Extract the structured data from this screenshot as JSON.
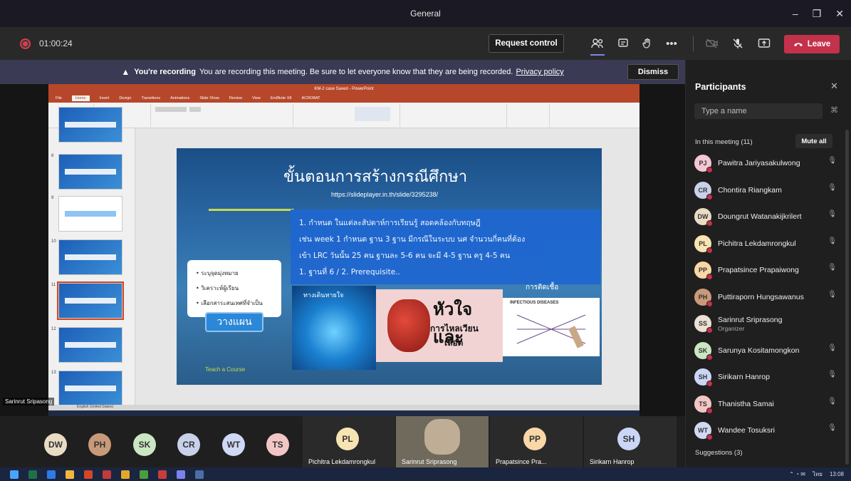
{
  "window": {
    "title": "General",
    "minimize": "–",
    "maximize": "❐",
    "close": "✕"
  },
  "toolbar": {
    "timer": "01:00:24",
    "request_control": "Request control",
    "more": "•••",
    "leave": "Leave"
  },
  "banner": {
    "bold": "You're recording",
    "message": "You are recording this meeting. Be sure to let everyone know that they are being recorded.",
    "link": "Privacy policy",
    "dismiss": "Dismiss"
  },
  "ppt": {
    "window_title": "KM-2 case Saved - PowerPoint",
    "tabs": [
      "File",
      "Home",
      "Insert",
      "Design",
      "Transitions",
      "Animations",
      "Slide Show",
      "Review",
      "View",
      "EndNote X8",
      "ACROBAT"
    ],
    "slide_numbers": [
      "8",
      "9",
      "10",
      "11",
      "12",
      "13"
    ],
    "status_text": "English (United States)",
    "presenter_label": "Sarinrut Sripasong"
  },
  "slide": {
    "title": "ขั้นตอนการสร้างกรณีศึกษา",
    "url": "https://slideplayer.in.th/slide/3295238/",
    "lines": [
      "1.   กำหนด ในแต่ละสัปดาห์การเรียนรู้ สอดคล้องกับทฤษฎี",
      "  เช่น week 1  กำหนด ฐาน 3 ฐาน มีกรณีในระบบ นศ จำนวนกี่คนที่ต้อง",
      "เข้า LRC วันนั้น 25 คน ฐานละ 5-6 คน จะมี 4-5 ฐาน ครู 4-5 คน",
      "1. ฐานที่ 6  /  2. Prerequisite.."
    ],
    "bullets": [
      "• ระบุจุดมุ่งหมาย",
      "• วิเคราะห์ผู้เรียน",
      "• เลือกสาระสนเทศที่จำเป็น"
    ],
    "plan_button": "วางแผน",
    "lungs_caption": "ทางเดินหายใจ",
    "heart_title": "หัวใจ และ",
    "heart_sub1": "การไหลเวียน",
    "heart_sub2": "เลือด",
    "infection_label": "การติดเชื้อ",
    "infection_heading": "INFECTIOUS DISEASES",
    "teach": "Teach a Course"
  },
  "panel": {
    "title": "Participants",
    "close": "✕",
    "search_placeholder": "Type a name",
    "in_meeting": "In this meeting (11)",
    "mute_all": "Mute all",
    "suggestions": "Suggestions (3)",
    "participants": [
      {
        "initials": "PJ",
        "name": "Pawitra Jariyasakulwong",
        "color": "#f4c7d3"
      },
      {
        "initials": "CR",
        "name": "Chontira Riangkam",
        "color": "#c8d1ea"
      },
      {
        "initials": "DW",
        "name": "Doungrut Watanakijkrilert",
        "color": "#e9dcc5"
      },
      {
        "initials": "PL",
        "name": "Pichitra Lekdamrongkul",
        "color": "#f6e4b2"
      },
      {
        "initials": "PP",
        "name": "Prapatsince Prapaiwong",
        "color": "#f9d7a6"
      },
      {
        "initials": "PH",
        "name": "Puttiraporn Hungsawanus",
        "color": "#c99a7a"
      },
      {
        "initials": "SS",
        "name": "Sarinrut Sriprasong",
        "sub": "Organizer",
        "color": "#ece1d4"
      },
      {
        "initials": "SK",
        "name": "Sarunya Kositamongkon",
        "color": "#c9e7c2"
      },
      {
        "initials": "SH",
        "name": "Sirikarn Hanrop",
        "color": "#cbd6f6"
      },
      {
        "initials": "TS",
        "name": "Thanistha Samai",
        "color": "#f3c6c6"
      },
      {
        "initials": "WT",
        "name": "Wandee Tosuksri",
        "color": "#cfd9f4"
      }
    ]
  },
  "strip": {
    "avatars": [
      {
        "initials": "DW",
        "color": "#e9dcc5"
      },
      {
        "initials": "PH",
        "color": "#c99a7a"
      },
      {
        "initials": "SK",
        "color": "#c9e7c2"
      },
      {
        "initials": "CR",
        "color": "#c8d1ea"
      },
      {
        "initials": "WT",
        "color": "#cfd9f4"
      },
      {
        "initials": "TS",
        "color": "#f3c6c6"
      }
    ],
    "tiles": [
      {
        "initials": "PL",
        "name": "Pichitra Lekdamrongkul",
        "color": "#f6e4b2"
      },
      {
        "name": "Sarinrut Sriprasong"
      },
      {
        "initials": "PP",
        "name": "Prapatsince Pra...",
        "color": "#f9d7a6"
      },
      {
        "initials": "SH",
        "name": "Sirikarn Hanrop",
        "color": "#cbd6f6"
      }
    ]
  },
  "taskbar": {
    "clock": "13:08",
    "lang": "ไทย"
  }
}
